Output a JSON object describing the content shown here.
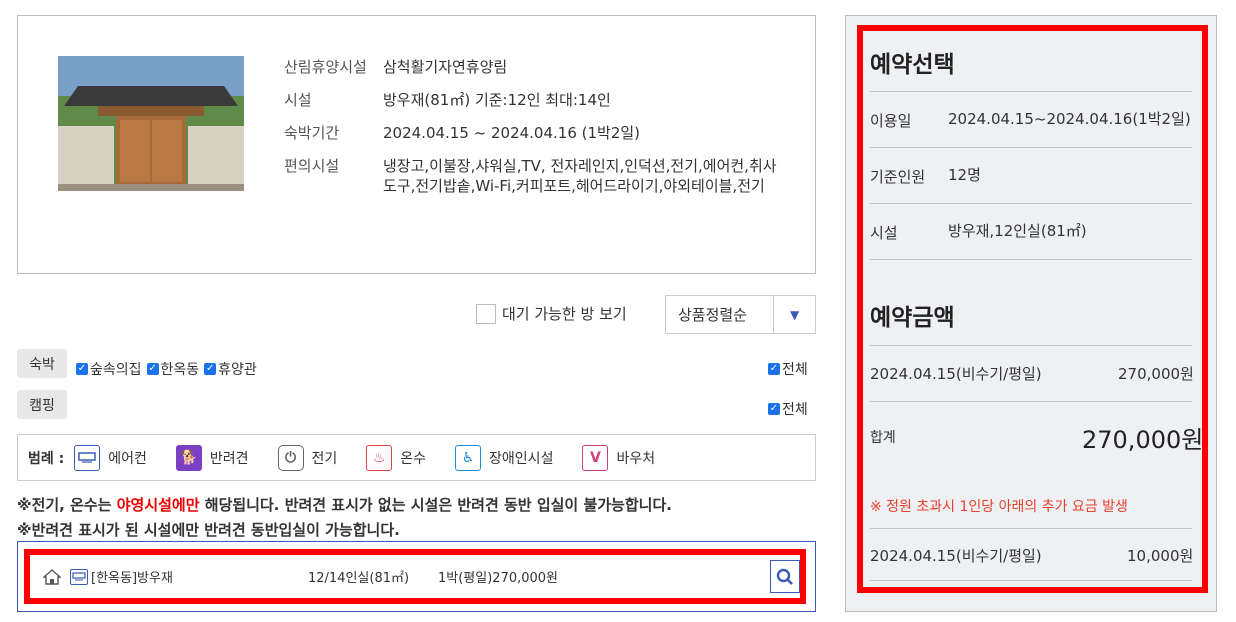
{
  "info": {
    "forest_label": "산림휴양시설",
    "forest_value": "삼척활기자연휴양림",
    "facility_label": "시설",
    "facility_value": "방우재(81㎡) 기준:12인 최대:14인",
    "period_label": "숙박기간",
    "period_value": "2024.04.15 ~ 2024.04.16 (1박2일)",
    "amenity_label": "편의시설",
    "amenity_value": "냉장고,이불장,샤워실,TV, 전자레인지,인덕션,전기,에어컨,취사도구,전기밥솥,Wi-Fi,커피포트,헤어드라이기,야외테이블,전기"
  },
  "filters": {
    "available_label": "대기 가능한 방 보기",
    "sort_label": "상품정렬순",
    "category_stay": "숙박",
    "category_camp": "캠핑",
    "check_forest_house": "숲속의집",
    "check_hanok": "한옥동",
    "check_rest": "휴양관",
    "all_label_1": "전체",
    "all_label_2": "전체"
  },
  "legend": {
    "title": "범례 :",
    "items": [
      {
        "label": "에어컨",
        "icon": "air-conditioner-icon",
        "color": "#3b5bb5"
      },
      {
        "label": "반려견",
        "icon": "pet-dog-icon",
        "color": "#7b3fc4"
      },
      {
        "label": "전기",
        "icon": "electric-plug-icon",
        "color": "#666666"
      },
      {
        "label": "온수",
        "icon": "hot-water-icon",
        "color": "#e0444c"
      },
      {
        "label": "장애인시설",
        "icon": "wheelchair-icon",
        "color": "#1f8fd6"
      },
      {
        "label": "바우처",
        "icon": "voucher-v-icon",
        "color": "#d0407a"
      }
    ]
  },
  "notices": {
    "line1_a": "※전기, 온수는 ",
    "line1_hl": "야영시설에만",
    "line1_b": " 해당됩니다. 반려견 표시가 없는 시설은 반려견 동반 입실이 불가능합니다.",
    "line2": "※반려견 표시가 된 시설에만 반려견 동반입실이 가능합니다."
  },
  "result": {
    "name": "[한옥동]방우재",
    "capacity": "12/14인실(81㎡)",
    "price": "1박(평일)270,000원"
  },
  "panel": {
    "title_select": "예약선택",
    "use_date_label": "이용일",
    "use_date_value": "2024.04.15~2024.04.16(1박2일)",
    "base_people_label": "기준인원",
    "base_people_value": "12명",
    "facility_label": "시설",
    "facility_value": "방우재,12인실(81㎡)",
    "title_amount": "예약금액",
    "line_date": "2024.04.15(비수기/평일)",
    "line_amount": "270,000원",
    "total_label": "합계",
    "total_value": "270,000원",
    "extra_note": "※ 정원 초과시 1인당 아래의 추가 요금 발생",
    "extra_date": "2024.04.15(비수기/평일)",
    "extra_amount": "10,000원"
  }
}
